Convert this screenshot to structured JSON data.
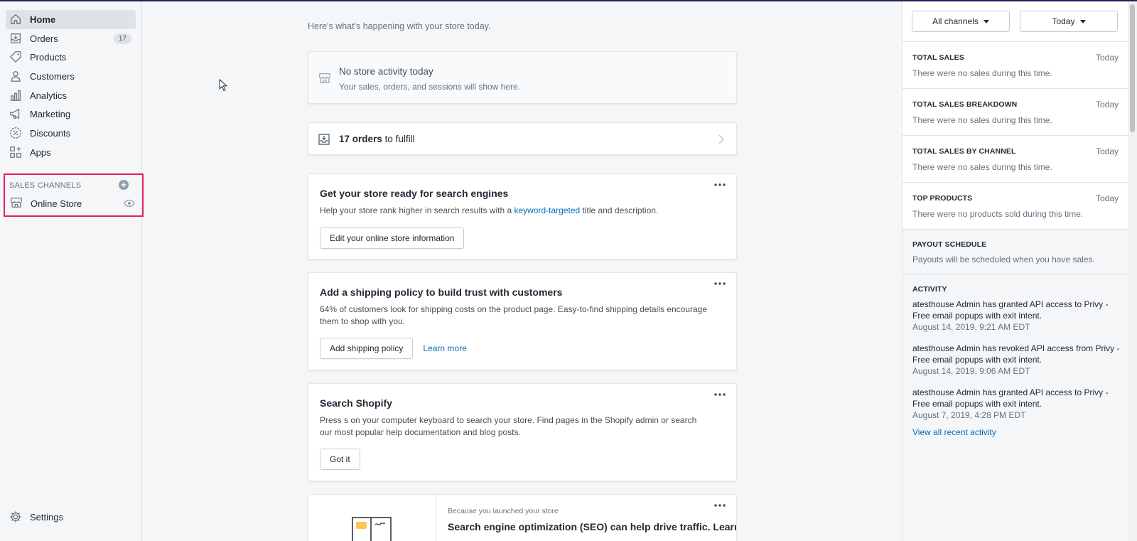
{
  "sidebar": {
    "items": [
      {
        "label": "Home",
        "icon": "home-icon",
        "active": true
      },
      {
        "label": "Orders",
        "icon": "orders-icon",
        "badge": "17"
      },
      {
        "label": "Products",
        "icon": "tag-icon"
      },
      {
        "label": "Customers",
        "icon": "person-icon"
      },
      {
        "label": "Analytics",
        "icon": "bar-chart-icon"
      },
      {
        "label": "Marketing",
        "icon": "megaphone-icon"
      },
      {
        "label": "Discounts",
        "icon": "discount-icon"
      },
      {
        "label": "Apps",
        "icon": "apps-icon"
      }
    ],
    "sales_channels": {
      "heading": "SALES CHANNELS",
      "item": "Online Store"
    },
    "settings": "Settings",
    "highlight_color": "#e0205f"
  },
  "main": {
    "greeting": "Here's what's happening with your store today.",
    "no_activity": {
      "title": "No store activity today",
      "subtitle": "Your sales, orders, and sessions will show here."
    },
    "orders": {
      "count_text": "17 orders",
      "suffix": "to fulfill"
    },
    "seo_card": {
      "title": "Get your store ready for search engines",
      "body_before": "Help your store rank higher in search results with a",
      "body_link": "keyword-targeted",
      "body_after": "title and description.",
      "button": "Edit your online store information"
    },
    "shipping_card": {
      "title": "Add a shipping policy to build trust with customers",
      "body": "64% of customers look for shipping costs on the product page. Easy-to-find shipping details encourage them to shop with you.",
      "button": "Add shipping policy",
      "link": "Learn more"
    },
    "search_card": {
      "title": "Search Shopify",
      "body": "Press s on your computer keyboard to search your store. Find pages in the Shopify admin or search our most popular help documentation and blog posts.",
      "button": "Got it"
    },
    "seo_traffic_card": {
      "eyebrow": "Because you launched your store",
      "title": "Search engine optimization (SEO) can help drive traffic. Learn"
    }
  },
  "right_panel": {
    "channel_filter": "All channels",
    "date_filter": "Today",
    "sections": [
      {
        "title": "TOTAL SALES",
        "when": "Today",
        "message": "There were no sales during this time."
      },
      {
        "title": "TOTAL SALES BREAKDOWN",
        "when": "Today",
        "message": "There were no sales during this time."
      },
      {
        "title": "TOTAL SALES BY CHANNEL",
        "when": "Today",
        "message": "There were no sales during this time."
      },
      {
        "title": "TOP PRODUCTS",
        "when": "Today",
        "message": "There were no products sold during this time."
      }
    ],
    "payout": {
      "title": "PAYOUT SCHEDULE",
      "message": "Payouts will be scheduled when you have sales."
    },
    "activity": {
      "title": "ACTIVITY",
      "items": [
        {
          "text": "atesthouse Admin has granted API access to Privy - Free email popups with exit intent.",
          "date": "August 14, 2019, 9:21 AM EDT"
        },
        {
          "text": "atesthouse Admin has revoked API access from Privy - Free email popups with exit intent.",
          "date": "August 14, 2019, 9:06 AM EDT"
        },
        {
          "text": "atesthouse Admin has granted API access to Privy - Free email popups with exit intent.",
          "date": "August 7, 2019, 4:28 PM EDT"
        }
      ],
      "view_all": "View all recent activity"
    }
  }
}
